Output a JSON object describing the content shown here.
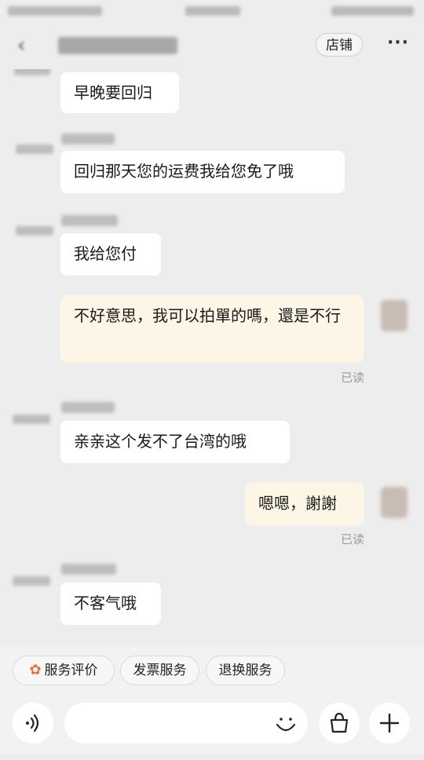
{
  "header": {
    "back_icon": "back-chevron-icon",
    "shop_label": "店铺",
    "more_icon": "more-dots-icon"
  },
  "messages": [
    {
      "from": "shop",
      "text": "早晚要回归"
    },
    {
      "from": "shop",
      "text": "回归那天您的运费我给您免了哦"
    },
    {
      "from": "shop",
      "text": "我给您付"
    },
    {
      "from": "me",
      "text": "不好意思，我可以拍單的嗎，還是不行",
      "status": "已读"
    },
    {
      "from": "shop",
      "text": "亲亲这个发不了台湾的哦"
    },
    {
      "from": "me",
      "text": "嗯嗯，謝謝",
      "status": "已读"
    },
    {
      "from": "shop",
      "text": "不客气哦"
    }
  ],
  "quick_actions": [
    {
      "label": "服务评价",
      "icon": "flower-icon"
    },
    {
      "label": "发票服务"
    },
    {
      "label": "退换服务"
    }
  ],
  "input": {
    "voice_icon": "voice-icon",
    "emoji_icon": "smiley-icon",
    "bag_icon": "shopping-bag-icon",
    "plus_icon": "plus-icon"
  },
  "colors": {
    "background": "#ededed",
    "my_bubble": "#fdf6e7",
    "their_bubble": "#ffffff",
    "accent": "#e8703a"
  }
}
